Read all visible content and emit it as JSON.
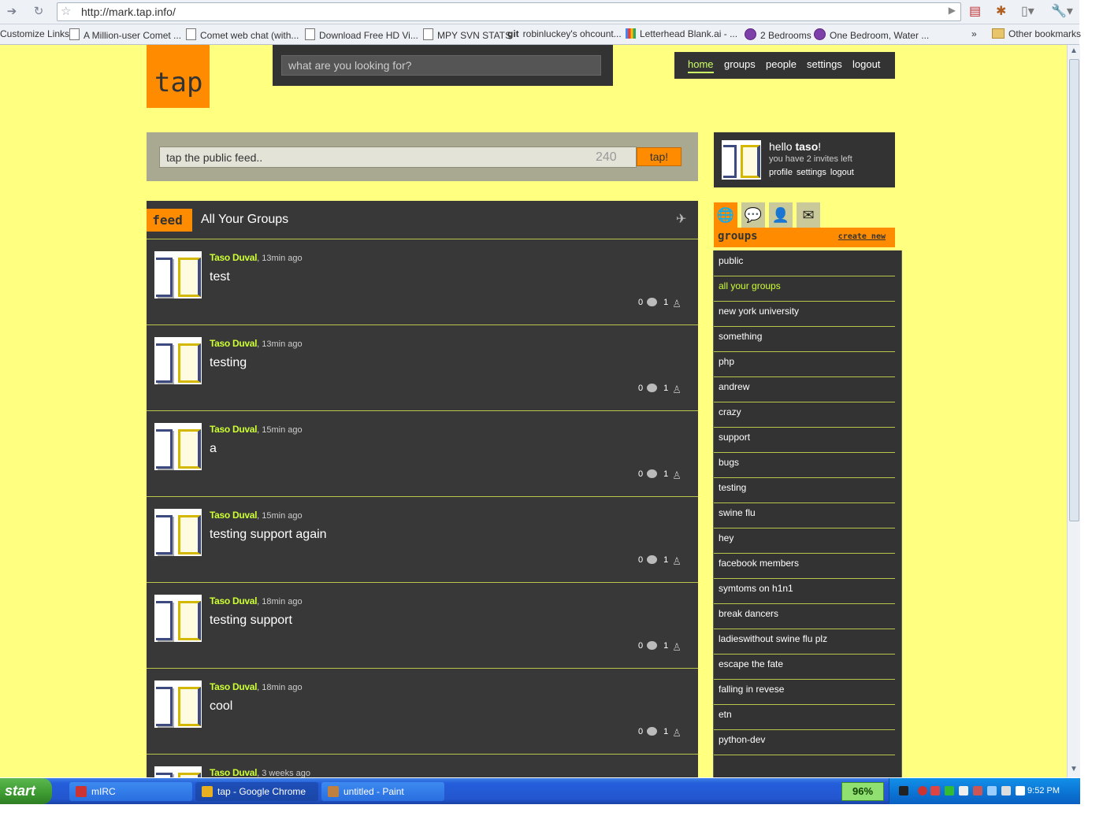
{
  "browser": {
    "url": "http://mark.tap.info/",
    "bookmarks": [
      {
        "label": "Customize Links",
        "icon": "none"
      },
      {
        "label": "A Million-user Comet ...",
        "icon": "page"
      },
      {
        "label": "Comet web chat (with...",
        "icon": "page"
      },
      {
        "label": "Download Free HD Vi...",
        "icon": "page"
      },
      {
        "label": "MPY SVN STATS",
        "icon": "page"
      },
      {
        "label": "robinluckey's ohcount...",
        "icon": "git",
        "prefix": "git"
      },
      {
        "label": "Letterhead Blank.ai - ...",
        "icon": "google"
      },
      {
        "label": "2 Bedrooms",
        "icon": "peace"
      },
      {
        "label": "One Bedroom, Water ...",
        "icon": "peace"
      },
      {
        "label": "Other bookmarks",
        "icon": "folder"
      }
    ],
    "overflow": "»"
  },
  "site": {
    "logo": "tap",
    "search_placeholder": "what are you looking for?",
    "nav": [
      "home",
      "groups",
      "people",
      "settings",
      "logout"
    ],
    "active_nav": "home"
  },
  "composer": {
    "placeholder": "tap the public feed..",
    "char_count": "240",
    "button": "tap!"
  },
  "feed": {
    "tab": "feed",
    "title": "All Your Groups",
    "posts": [
      {
        "author": "Taso Duval",
        "time": ", 13min ago",
        "text": "test",
        "comments": "0",
        "people": "1"
      },
      {
        "author": "Taso Duval",
        "time": ", 13min ago",
        "text": "testing",
        "comments": "0",
        "people": "1"
      },
      {
        "author": "Taso Duval",
        "time": ", 15min ago",
        "text": "a",
        "comments": "0",
        "people": "1"
      },
      {
        "author": "Taso Duval",
        "time": ", 15min ago",
        "text": "testing support again",
        "comments": "0",
        "people": "1"
      },
      {
        "author": "Taso Duval",
        "time": ", 18min ago",
        "text": "testing support",
        "comments": "0",
        "people": "1"
      },
      {
        "author": "Taso Duval",
        "time": ", 18min ago",
        "text": "cool",
        "comments": "0",
        "people": "1"
      },
      {
        "author": "Taso Duval",
        "time": ", 3 weeks ago",
        "text": "",
        "comments": "",
        "people": ""
      }
    ]
  },
  "user": {
    "hello": "hello ",
    "name": "taso",
    "exclaim": "!",
    "invites": "you have 2 invites left",
    "links": [
      "profile",
      "settings",
      "logout"
    ]
  },
  "sidebar": {
    "icon_tabs": [
      "globe-icon",
      "speech-bubble-icon",
      "person-icon",
      "envelope-icon"
    ],
    "groups_title": "groups",
    "create_new": "create new",
    "groups": [
      "public",
      "all your groups",
      "new york university",
      "something",
      "php",
      "andrew",
      "crazy",
      "support",
      "bugs",
      "testing",
      "swine flu",
      "hey",
      "facebook members",
      "symtoms on h1n1",
      "break dancers",
      "ladieswithout swine flu plz",
      "escape the fate",
      "falling in revese",
      "etn",
      "python-dev"
    ],
    "active_group": "all your groups"
  },
  "taskbar": {
    "start": "start",
    "tasks": [
      {
        "label": "mIRC",
        "color": "#cc3333"
      },
      {
        "label": "tap - Google Chrome",
        "color": "#e8b020"
      },
      {
        "label": "untitled - Paint",
        "color": "#c08040"
      }
    ],
    "battery": "96%",
    "clock": "9:52 PM"
  }
}
